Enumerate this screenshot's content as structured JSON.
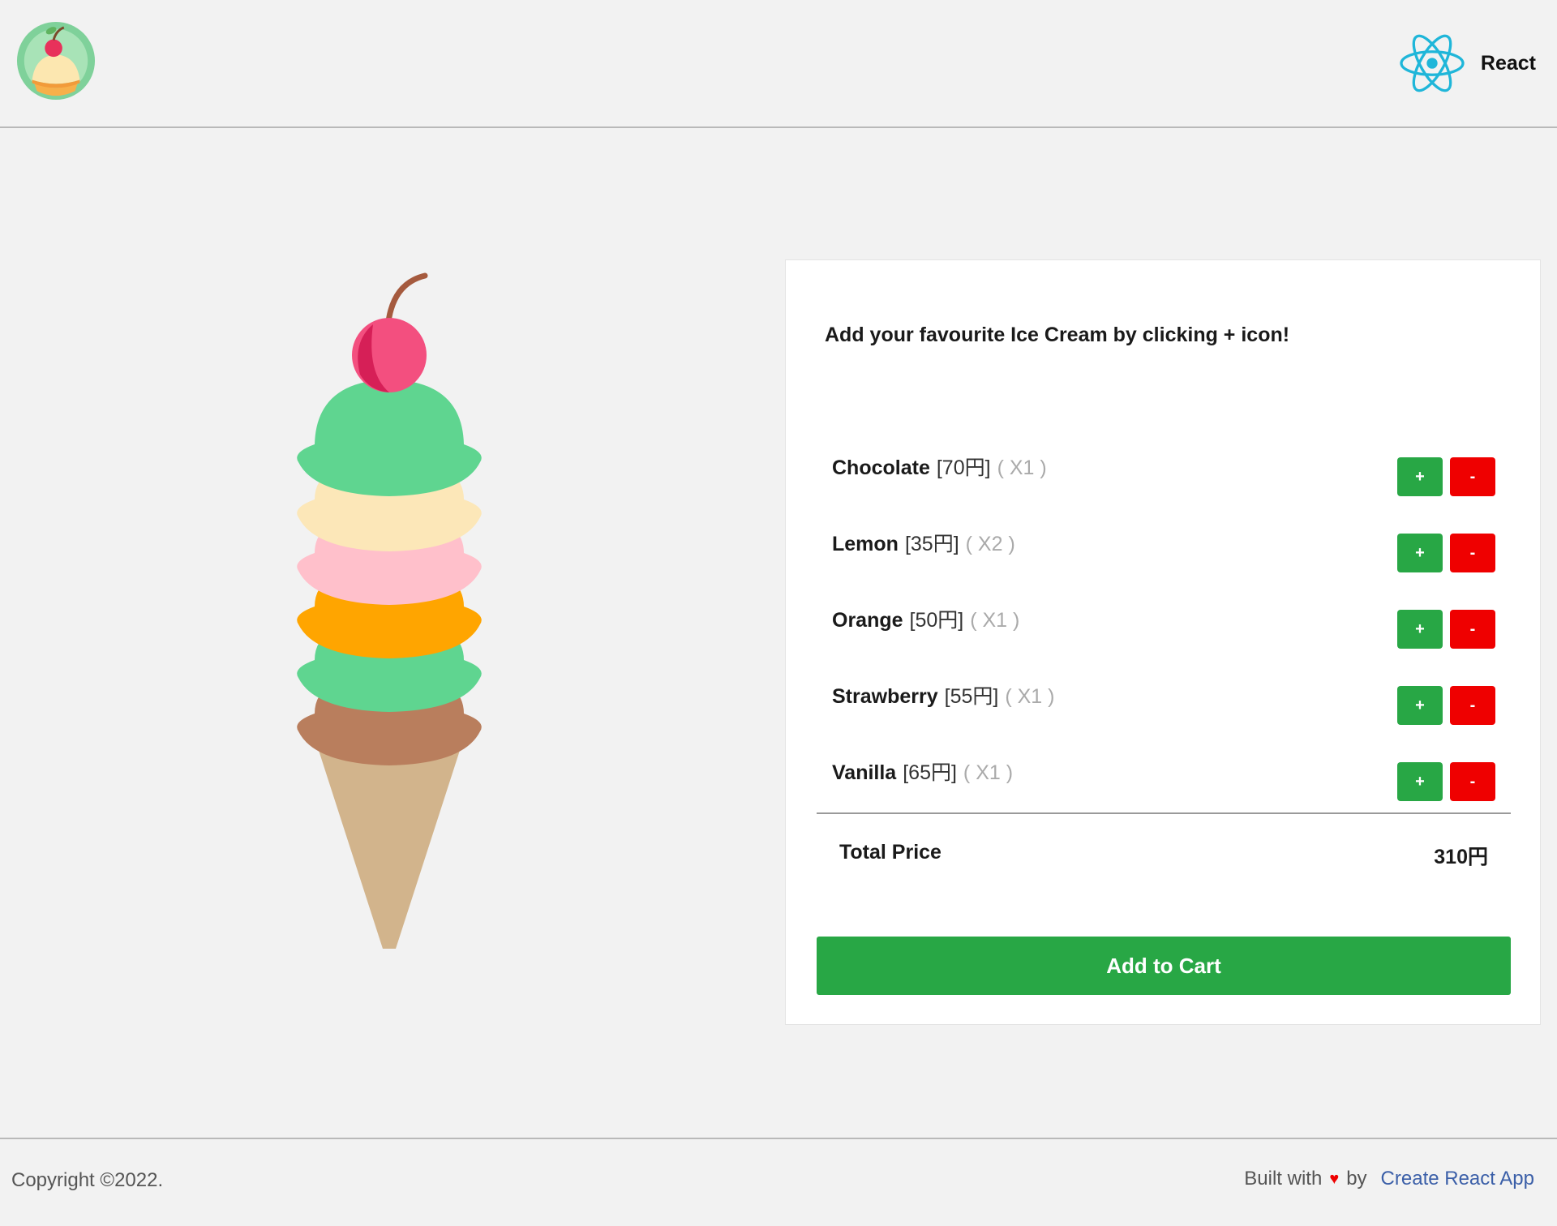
{
  "header": {
    "logo_icon": "ice-cream-logo-icon",
    "react_icon": "react-atom-icon",
    "react_label": "React"
  },
  "hero": {
    "image_icon": "ice-cream-cone-icon"
  },
  "card": {
    "title": "Add your favourite Ice Cream by clicking + icon!",
    "flavors": [
      {
        "name": "Chocolate",
        "price": "[70円]",
        "qty": "( X1 )"
      },
      {
        "name": "Lemon",
        "price": "[35円]",
        "qty": "( X2 )"
      },
      {
        "name": "Orange",
        "price": "[50円]",
        "qty": "( X1 )"
      },
      {
        "name": "Strawberry",
        "price": "[55円]",
        "qty": "( X1 )"
      },
      {
        "name": "Vanilla",
        "price": "[65円]",
        "qty": "( X1 )"
      }
    ],
    "plus_label": "+",
    "minus_label": "-",
    "total_label": "Total Price",
    "total_value": "310円",
    "add_to_cart_label": "Add to Cart"
  },
  "footer": {
    "copyright": "Copyright ©2022.",
    "built_prefix": "Built with",
    "heart_icon": "♥",
    "built_by": "by",
    "link_label": "Create React App"
  },
  "colors": {
    "plus_button": "#28a745",
    "minus_button": "#ef0000",
    "cart_button": "#28a745",
    "link": "#3b5fa8"
  }
}
